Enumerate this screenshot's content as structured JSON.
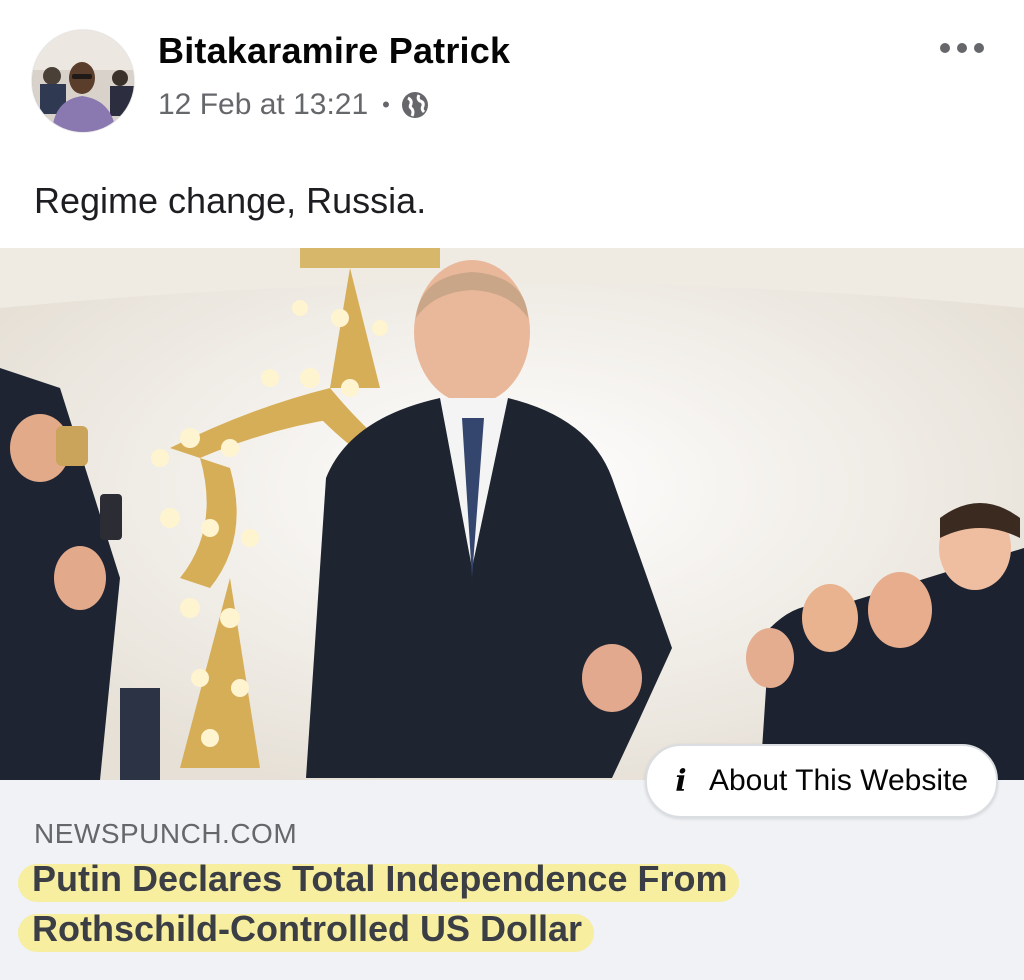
{
  "post": {
    "author": "Bitakaramire Patrick",
    "timestamp": "12 Feb at 13:21",
    "separator": "•",
    "audience_icon": "globe-icon",
    "more_icon": "more-options-icon",
    "text": "Regime change, Russia."
  },
  "link_preview": {
    "about_label": "About This Website",
    "about_icon": "info-icon",
    "domain": "NEWSPUNCH.COM",
    "headline_line1": "Putin Declares Total Independence From",
    "headline_line2": "Rothschild-Controlled US Dollar",
    "highlight_color": "#faec82"
  },
  "colors": {
    "secondary_text": "#65676b",
    "preview_background": "#f0f2f5"
  }
}
